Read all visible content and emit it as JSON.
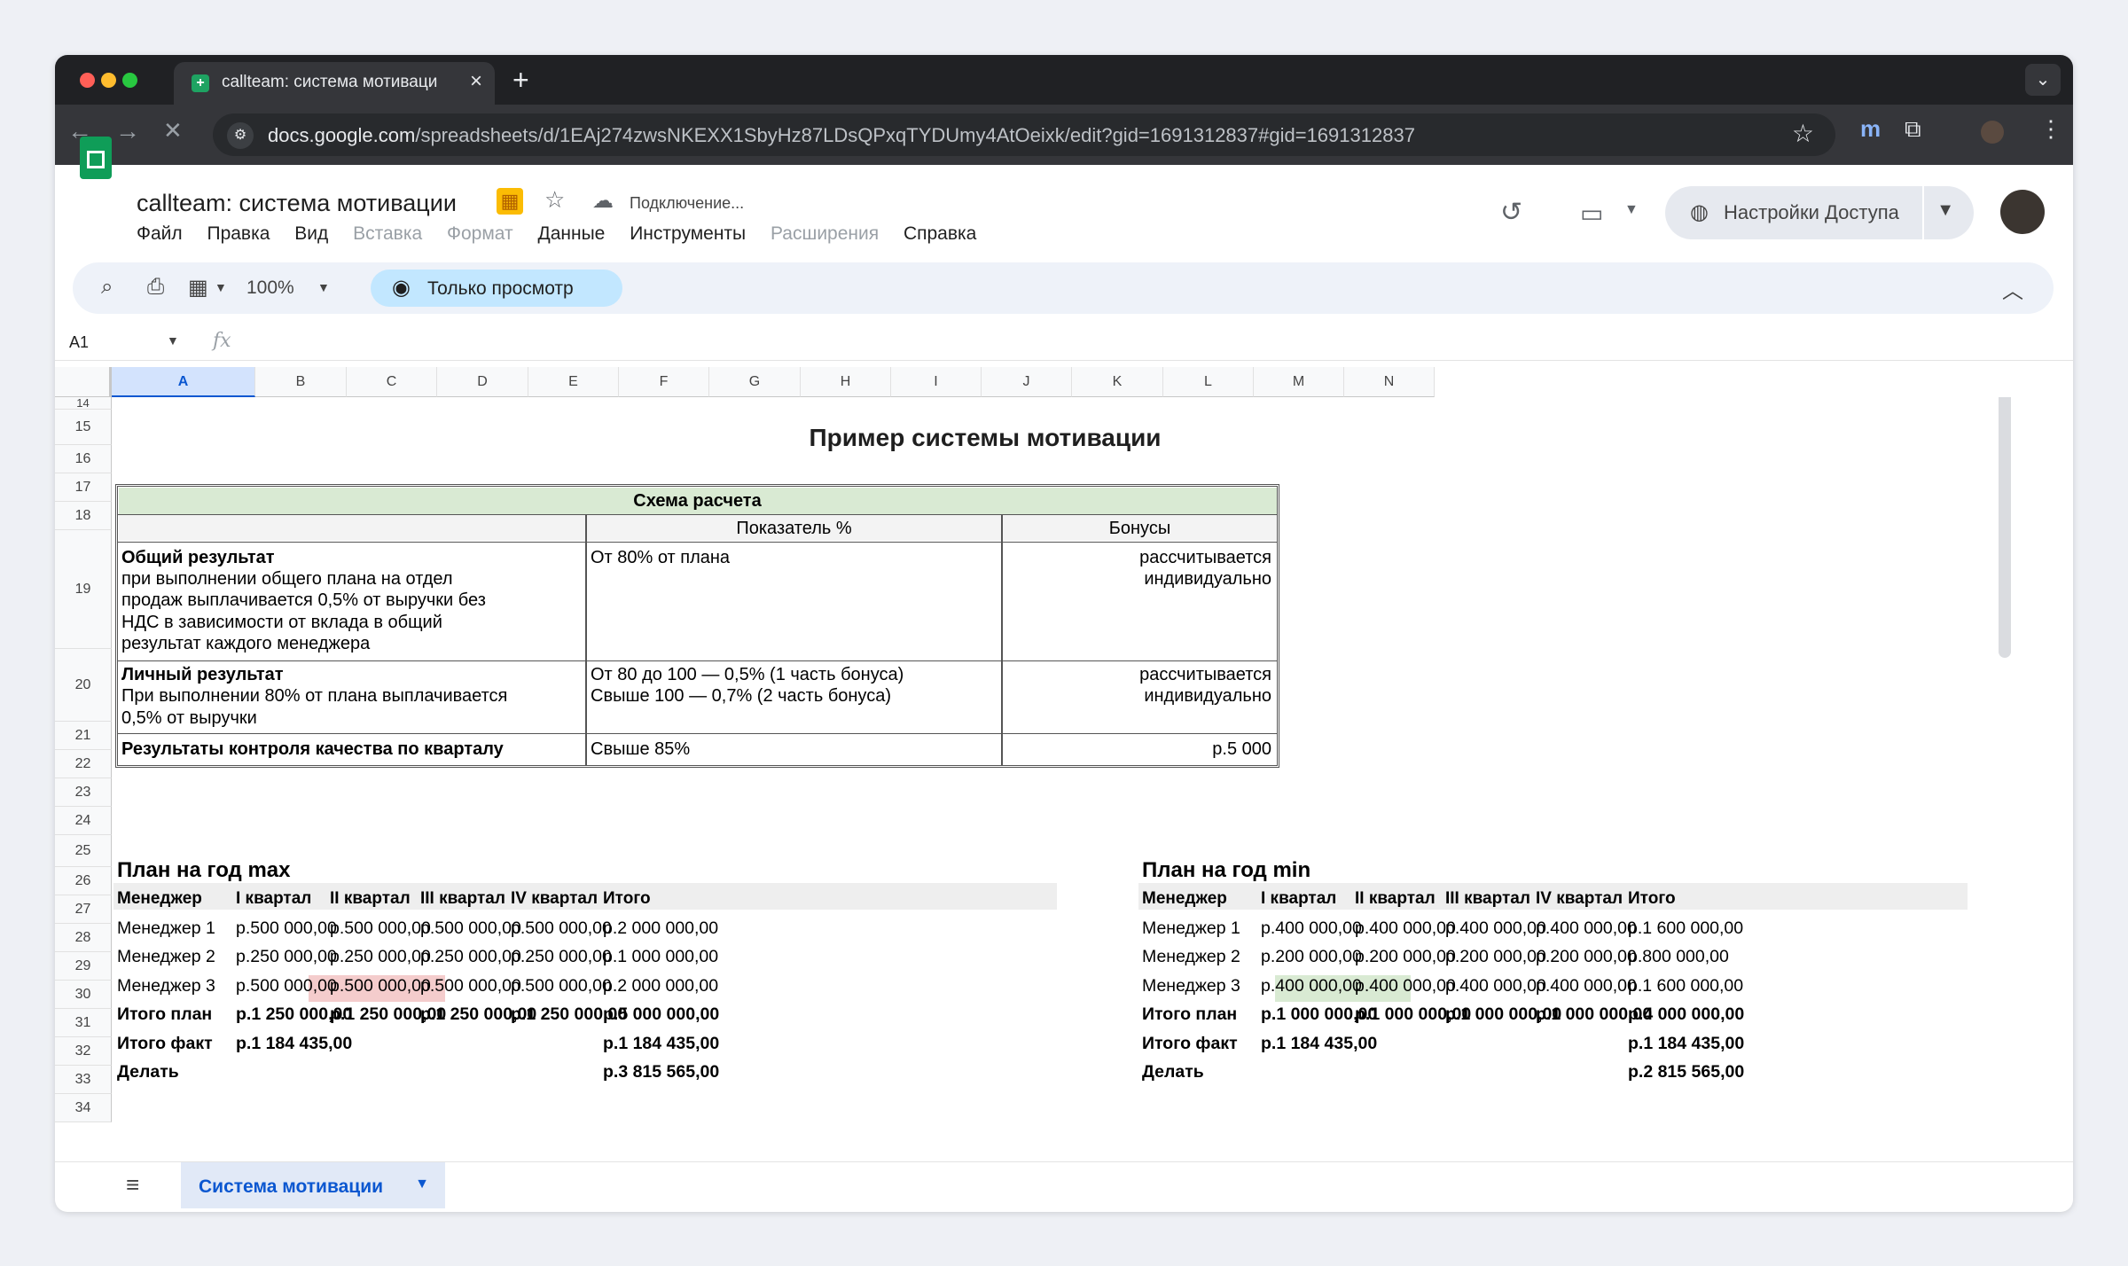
{
  "browser": {
    "tab_title": "callteam: система мотиваци",
    "url_host": "docs.google.com",
    "url_path": "/spreadsheets/d/1EAj274zwsNKEXX1SbyHz87LDsQPxqTYDUmy4AtOeixk/edit?gid=1691312837#gid=1691312837"
  },
  "doc": {
    "title": "callteam: система мотивации",
    "status": "Подключение...",
    "menus": [
      "Файл",
      "Правка",
      "Вид",
      "Вставка",
      "Формат",
      "Данные",
      "Инструменты",
      "Расширения",
      "Справка"
    ],
    "share_label": "Настройки Доступа"
  },
  "toolbar": {
    "zoom": "100%",
    "view_only": "Только просмотр"
  },
  "formula_bar": {
    "cell_ref": "A1",
    "fx": "fx"
  },
  "grid": {
    "columns": [
      "A",
      "B",
      "C",
      "D",
      "E",
      "F",
      "G",
      "H",
      "I",
      "J",
      "K",
      "L",
      "M",
      "N"
    ],
    "rows": [
      "14",
      "15",
      "16",
      "17",
      "18",
      "19",
      "20",
      "21",
      "22",
      "23",
      "24",
      "25",
      "26",
      "27",
      "28",
      "29",
      "30",
      "31",
      "32",
      "33",
      "34"
    ]
  },
  "sheet": {
    "heading": "Пример системы мотивации",
    "scheme": {
      "title": "Схема расчета",
      "col_indicator": "Показатель %",
      "col_bonus": "Бонусы",
      "row1": {
        "title": "Общий результат",
        "desc": [
          "при выполнении общего плана на отдел",
          "продаж выплачивается 0,5% от выручки без",
          "НДС в зависимости от вклада в общий",
          "результат каждого менеджера"
        ],
        "indicator": "От 80% от плана",
        "bonus": [
          "рассчитывается",
          "индивидуально"
        ]
      },
      "row2": {
        "title": "Личный результат",
        "desc": [
          "При выполнении 80% от плана выплачивается",
          "0,5% от выручки"
        ],
        "indicator": [
          "От 80 до 100 — 0,5% (1 часть бонуса)",
          "Свыше 100 — 0,7% (2 часть бонуса)"
        ],
        "bonus": [
          "рассчитывается",
          "индивидуально"
        ]
      },
      "row3": {
        "title": "Результаты контроля качества по кварталу",
        "indicator": "Свыше 85%",
        "bonus": "р.5 000"
      }
    },
    "plan_max": {
      "title": "План на год max",
      "headers": [
        "Менеджер",
        "I квартал",
        "II квартал",
        "III квартал",
        "IV квартал",
        "Итого"
      ],
      "rows": [
        [
          "Менеджер 1",
          "р.500 000,00",
          "р.500 000,00",
          "р.500 000,00",
          "р.500 000,00",
          "р.2 000 000,00"
        ],
        [
          "Менеджер 2",
          "р.250 000,00",
          "р.250 000,00",
          "р.250 000,00",
          "р.250 000,00",
          "р.1 000 000,00"
        ],
        [
          "Менеджер 3",
          "р.500 000,00",
          "р.500 000,00",
          "р.500 000,00",
          "р.500 000,00",
          "р.2 000 000,00"
        ],
        [
          "Итого план",
          "р.1 250 000,00",
          "р.1 250 000,00",
          "р.1 250 000,00",
          "р.1 250 000,00",
          "р.5 000 000,00"
        ],
        [
          "Итого факт",
          "р.1 184 435,00",
          "",
          "",
          "",
          "р.1 184 435,00"
        ],
        [
          "Делать",
          "",
          "",
          "",
          "",
          "р.3 815 565,00"
        ]
      ]
    },
    "plan_min": {
      "title": "План на год min",
      "headers": [
        "Менеджер",
        "I квартал",
        "II квартал",
        "III квартал",
        "IV квартал",
        "Итого"
      ],
      "rows": [
        [
          "Менеджер 1",
          "р.400 000,00",
          "р.400 000,00",
          "р.400 000,00",
          "р.400 000,00",
          "р.1 600 000,00"
        ],
        [
          "Менеджер 2",
          "р.200 000,00",
          "р.200 000,00",
          "р.200 000,00",
          "р.200 000,00",
          "р.800 000,00"
        ],
        [
          "Менеджер 3",
          "р.400 000,00",
          "р.400 000,00",
          "р.400 000,00",
          "р.400 000,00",
          "р.1 600 000,00"
        ],
        [
          "Итого план",
          "р.1 000 000,00",
          "р.1 000 000,00",
          "р.1 000 000,00",
          "р.1 000 000,00",
          "р.4 000 000,00"
        ],
        [
          "Итого факт",
          "р.1 184 435,00",
          "",
          "",
          "",
          "р.1 184 435,00"
        ],
        [
          "Делать",
          "",
          "",
          "",
          "",
          "р.2 815 565,00"
        ]
      ]
    }
  },
  "sheet_tab": {
    "label": "Система мотивации"
  },
  "colors": {
    "accent": "#0b57d0",
    "sheets_green": "#0f9d58",
    "fact_red": "#f4cccc",
    "fact_green": "#d9ead3"
  }
}
